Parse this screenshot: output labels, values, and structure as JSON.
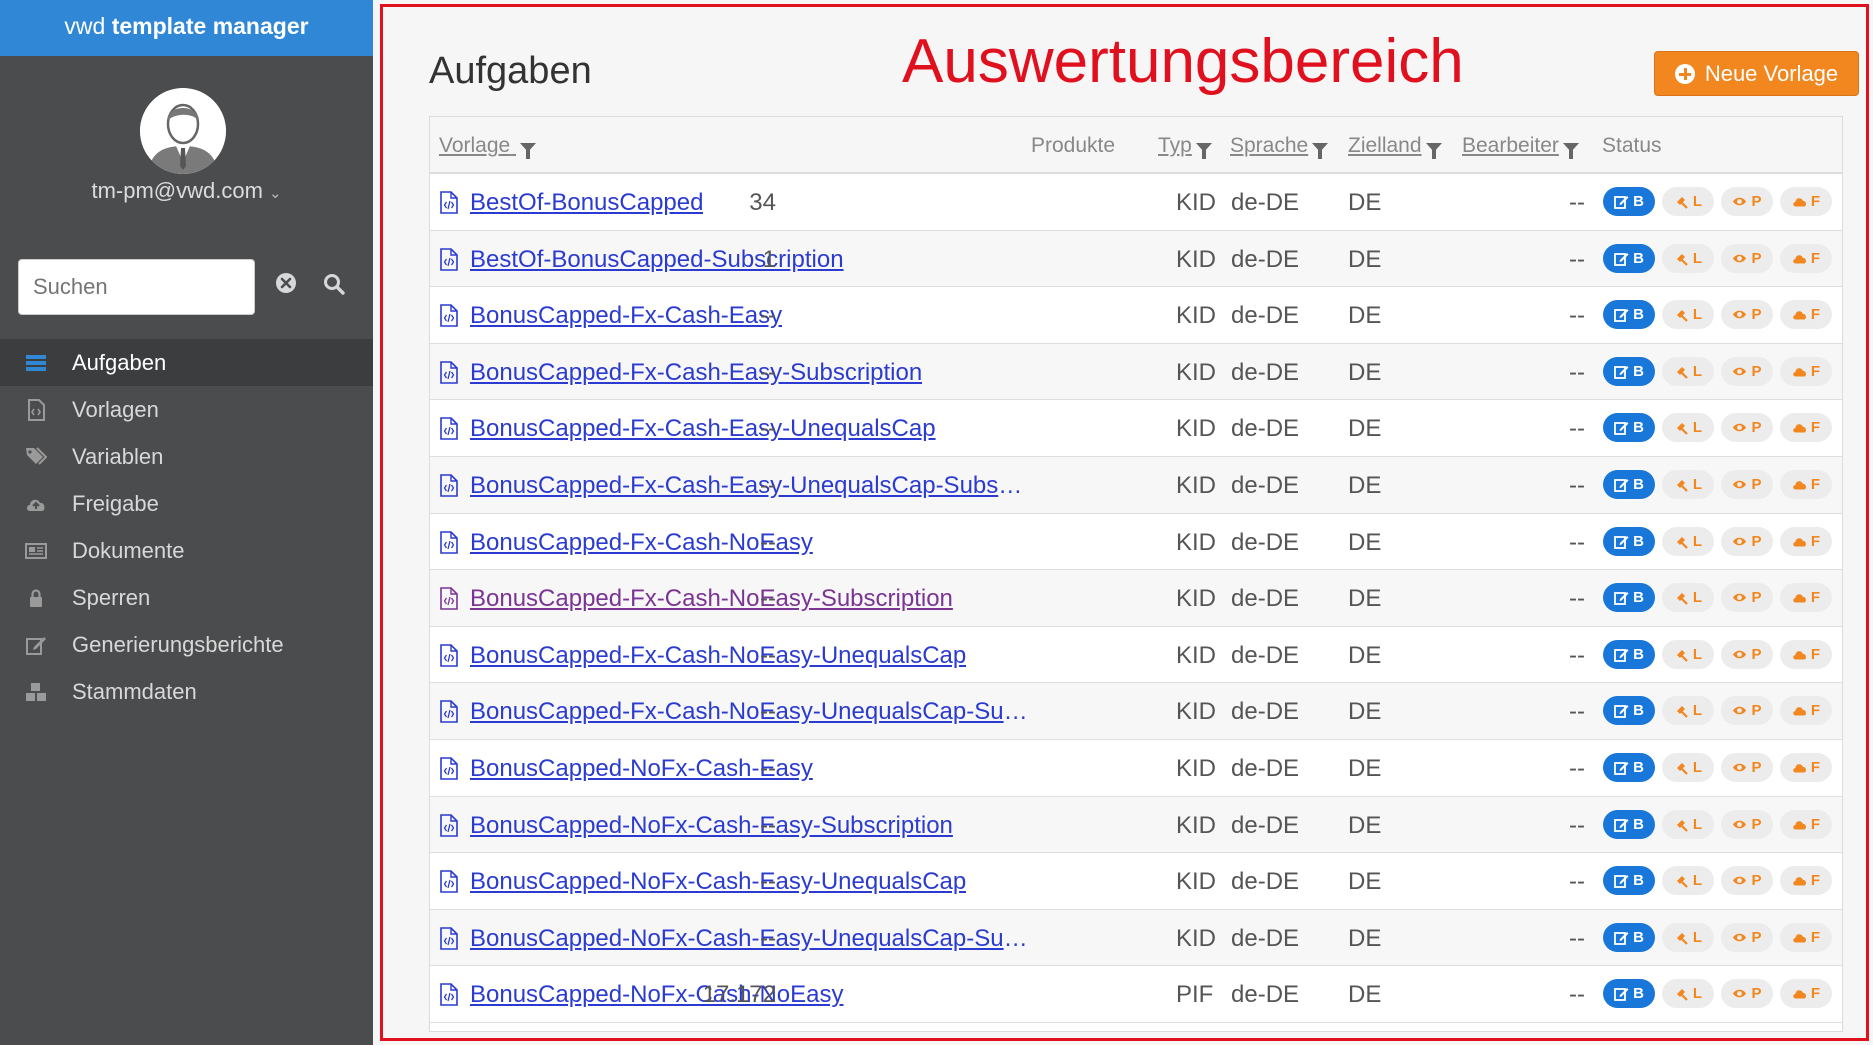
{
  "app": {
    "brand_light": "vwd ",
    "brand_bold": "template manager"
  },
  "user": {
    "email": "tm-pm@vwd.com"
  },
  "search": {
    "placeholder": "Suchen"
  },
  "nav": [
    {
      "label": "Aufgaben",
      "icon": "tasks-icon",
      "active": true
    },
    {
      "label": "Vorlagen",
      "icon": "template-file-icon"
    },
    {
      "label": "Variablen",
      "icon": "tags-icon"
    },
    {
      "label": "Freigabe",
      "icon": "cloud-upload-icon"
    },
    {
      "label": "Dokumente",
      "icon": "newspaper-icon"
    },
    {
      "label": "Sperren",
      "icon": "lock-icon"
    },
    {
      "label": "Generierungsberichte",
      "icon": "edit-icon"
    },
    {
      "label": "Stammdaten",
      "icon": "cubes-icon"
    }
  ],
  "page": {
    "title": "Aufgaben",
    "annotation": "Auswertungsbereich",
    "new_button": "Neue Vorlage"
  },
  "table": {
    "headers": {
      "vorlage": "Vorlage",
      "produkte": "Produkte",
      "typ": "Typ",
      "sprache": "Sprache",
      "zielland": "Zielland",
      "bearbeiter": "Bearbeiter",
      "status": "Status"
    },
    "badges": [
      "B",
      "L",
      "P",
      "F"
    ],
    "rows": [
      {
        "name": "BestOf-BonusCapped",
        "produkte": "34",
        "typ": "KID",
        "sprache": "de-DE",
        "zielland": "DE",
        "bearbeiter": "--"
      },
      {
        "name": "BestOf-BonusCapped-Subscription",
        "produkte": "1",
        "typ": "KID",
        "sprache": "de-DE",
        "zielland": "DE",
        "bearbeiter": "--"
      },
      {
        "name": "BonusCapped-Fx-Cash-Easy",
        "produkte": "--",
        "typ": "KID",
        "sprache": "de-DE",
        "zielland": "DE",
        "bearbeiter": "--"
      },
      {
        "name": "BonusCapped-Fx-Cash-Easy-Subscription",
        "produkte": "--",
        "typ": "KID",
        "sprache": "de-DE",
        "zielland": "DE",
        "bearbeiter": "--"
      },
      {
        "name": "BonusCapped-Fx-Cash-Easy-UnequalsCap",
        "produkte": "--",
        "typ": "KID",
        "sprache": "de-DE",
        "zielland": "DE",
        "bearbeiter": "--"
      },
      {
        "name": "BonusCapped-Fx-Cash-Easy-UnequalsCap-Subscri...",
        "produkte": "--",
        "typ": "KID",
        "sprache": "de-DE",
        "zielland": "DE",
        "bearbeiter": "--"
      },
      {
        "name": "BonusCapped-Fx-Cash-NoEasy",
        "produkte": "--",
        "typ": "KID",
        "sprache": "de-DE",
        "zielland": "DE",
        "bearbeiter": "--"
      },
      {
        "name": "BonusCapped-Fx-Cash-NoEasy-Subscription",
        "produkte": "--",
        "typ": "KID",
        "sprache": "de-DE",
        "zielland": "DE",
        "bearbeiter": "--",
        "visited": true
      },
      {
        "name": "BonusCapped-Fx-Cash-NoEasy-UnequalsCap",
        "produkte": "--",
        "typ": "KID",
        "sprache": "de-DE",
        "zielland": "DE",
        "bearbeiter": "--"
      },
      {
        "name": "BonusCapped-Fx-Cash-NoEasy-UnequalsCap-Sub...",
        "produkte": "--",
        "typ": "KID",
        "sprache": "de-DE",
        "zielland": "DE",
        "bearbeiter": "--"
      },
      {
        "name": "BonusCapped-NoFx-Cash-Easy",
        "produkte": "--",
        "typ": "KID",
        "sprache": "de-DE",
        "zielland": "DE",
        "bearbeiter": "--"
      },
      {
        "name": "BonusCapped-NoFx-Cash-Easy-Subscription",
        "produkte": "--",
        "typ": "KID",
        "sprache": "de-DE",
        "zielland": "DE",
        "bearbeiter": "--"
      },
      {
        "name": "BonusCapped-NoFx-Cash-Easy-UnequalsCap",
        "produkte": "--",
        "typ": "KID",
        "sprache": "de-DE",
        "zielland": "DE",
        "bearbeiter": "--"
      },
      {
        "name": "BonusCapped-NoFx-Cash-Easy-UnequalsCap-Sub...",
        "produkte": "--",
        "typ": "KID",
        "sprache": "de-DE",
        "zielland": "DE",
        "bearbeiter": "--"
      },
      {
        "name": "BonusCapped-NoFx-Cash-NoEasy",
        "produkte": "17.172",
        "typ": "PIF",
        "sprache": "de-DE",
        "zielland": "DE",
        "bearbeiter": "--"
      }
    ]
  },
  "colors": {
    "brand": "#2f87d6",
    "sidebar": "#4b4c4e",
    "accent": "#f2861f",
    "annotation": "#e0101e",
    "link": "#2b3bd1"
  }
}
